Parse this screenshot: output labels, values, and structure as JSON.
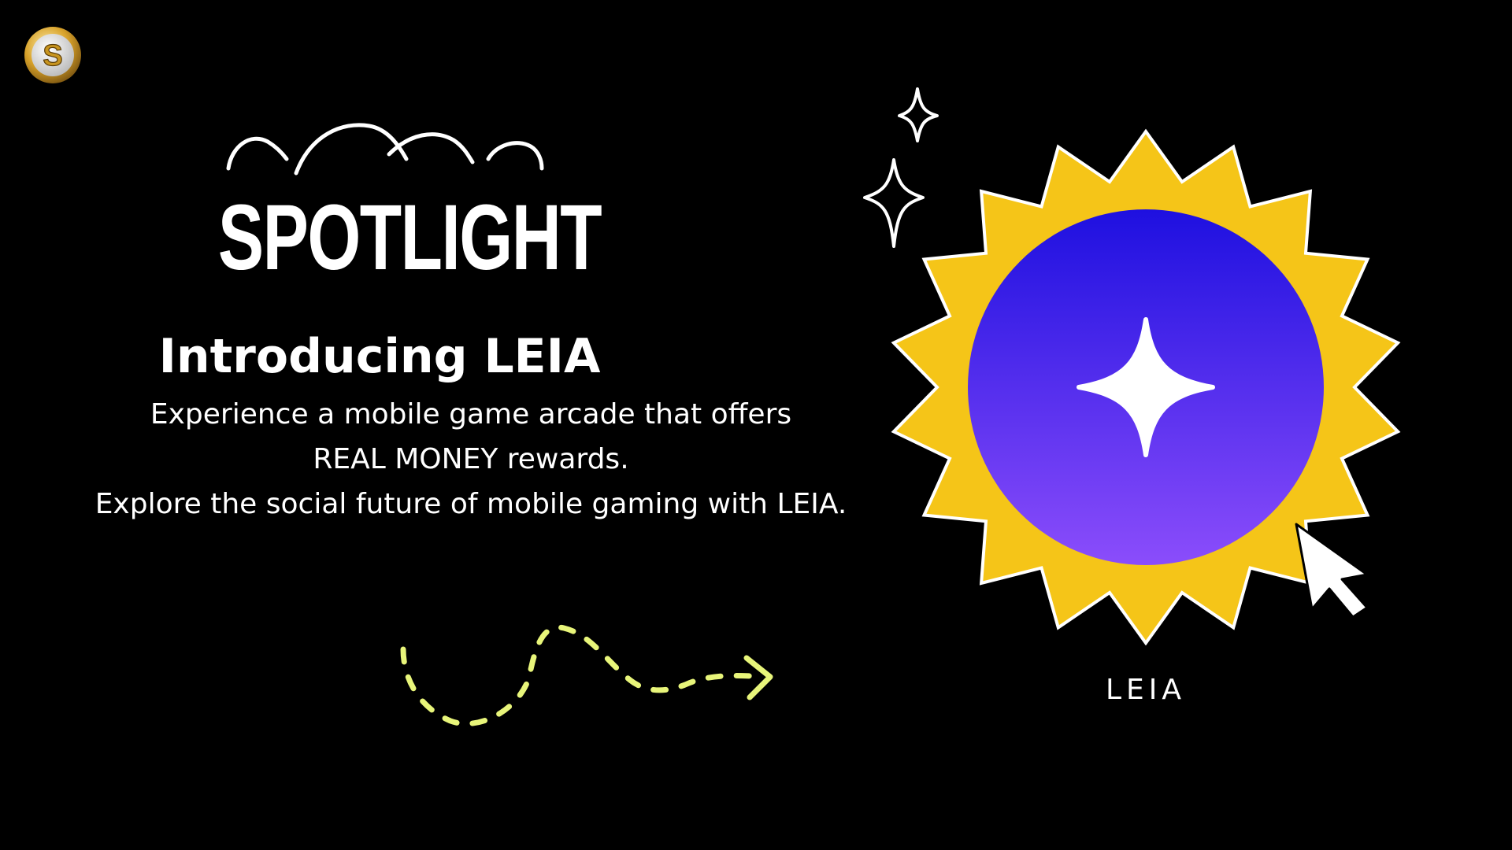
{
  "brand": {
    "logo_letter": "S",
    "logo_colors": [
      "#c79a2c",
      "#f5d77a",
      "#2a2a2a"
    ]
  },
  "spotlight": {
    "title": "SPOTLIGHT",
    "subtitle": "Introducing LEIA",
    "description_lines": [
      "Experience a mobile game arcade that offers",
      "REAL MONEY rewards.",
      "Explore the social future of mobile gaming with LEIA."
    ]
  },
  "badge": {
    "label": "LEIA",
    "icon": "four-point-star-icon",
    "burst_color": "#f5c518",
    "circle_gradient_top": "#1e10e0",
    "circle_gradient_bottom": "#8b4dfb"
  },
  "decorations": {
    "arrow_color": "#e8f57a",
    "sparkle_icon": "sparkle-icon",
    "cursor_icon": "pointer-cursor-icon"
  }
}
